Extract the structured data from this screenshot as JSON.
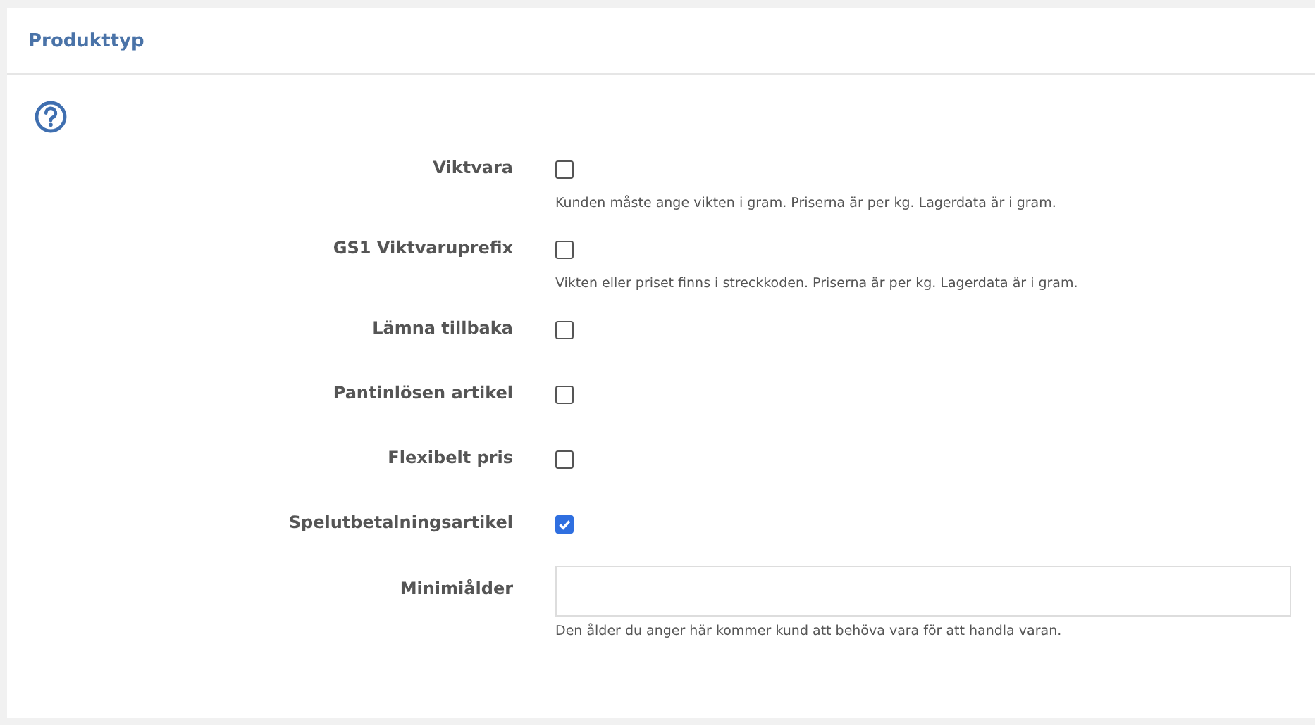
{
  "panel": {
    "title": "Produkttyp"
  },
  "fields": [
    {
      "kind": "checkbox",
      "label": "Viktvara",
      "checked": false,
      "help": "Kunden måste ange vikten i gram. Priserna är per kg. Lagerdata är i gram."
    },
    {
      "kind": "checkbox",
      "label": "GS1 Viktvaruprefix",
      "checked": false,
      "help": "Vikten eller priset finns i streckkoden. Priserna är per kg. Lagerdata är i gram."
    },
    {
      "kind": "checkbox",
      "label": "Lämna tillbaka",
      "checked": false
    },
    {
      "kind": "checkbox",
      "label": "Pantinlösen artikel",
      "checked": false
    },
    {
      "kind": "checkbox",
      "label": "Flexibelt pris",
      "checked": false
    },
    {
      "kind": "checkbox",
      "label": "Spelutbetalningsartikel",
      "checked": true
    },
    {
      "kind": "text",
      "label": "Minimiålder",
      "help": "Den ålder du anger här kommer kund att behöva vara för att handla varan."
    }
  ]
}
